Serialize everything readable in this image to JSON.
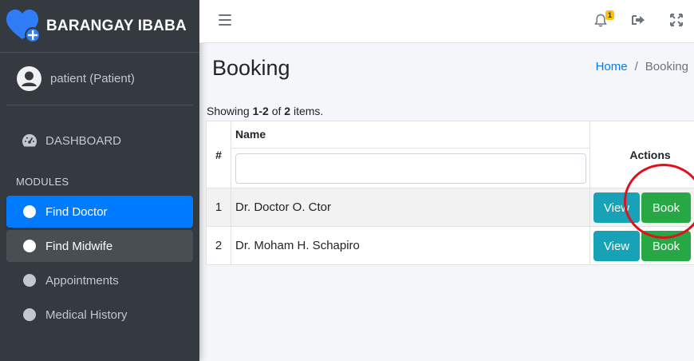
{
  "brand": {
    "name": "BARANGAY IBABA",
    "logo_icon": "heart-plus-icon",
    "accent_color": "#2f7df6"
  },
  "user": {
    "name": "patient (Patient)",
    "avatar_icon": "user-circle-icon"
  },
  "sidebar": {
    "dashboard_label": "DASHBOARD",
    "modules_header": "MODULES",
    "items": [
      {
        "label": "Find Doctor",
        "state": "active"
      },
      {
        "label": "Find Midwife",
        "state": "hover"
      },
      {
        "label": "Appointments",
        "state": "normal"
      },
      {
        "label": "Medical History",
        "state": "normal"
      }
    ]
  },
  "navbar": {
    "notification_count": "1",
    "icons": [
      "menu-icon",
      "bell-icon",
      "sign-out-icon",
      "expand-icon"
    ]
  },
  "page": {
    "title": "Booking",
    "breadcrumb": {
      "home": "Home",
      "separator": "/",
      "current": "Booking"
    }
  },
  "grid": {
    "summary": {
      "prefix": "Showing ",
      "range": "1-2",
      "of": " of ",
      "total": "2",
      "suffix": " items."
    },
    "headers": {
      "num": "#",
      "name": "Name",
      "actions": "Actions"
    },
    "filter_value": "",
    "rows": [
      {
        "num": "1",
        "name": "Dr. Doctor O. Ctor",
        "view": "View",
        "book": "Book"
      },
      {
        "num": "2",
        "name": "Dr. Moham H. Schapiro",
        "view": "View",
        "book": "Book"
      }
    ]
  },
  "colors": {
    "primary": "#007bff",
    "info": "#17a2b8",
    "success": "#28a745",
    "sidebar": "#343a40",
    "annotation": "#e0101e"
  }
}
